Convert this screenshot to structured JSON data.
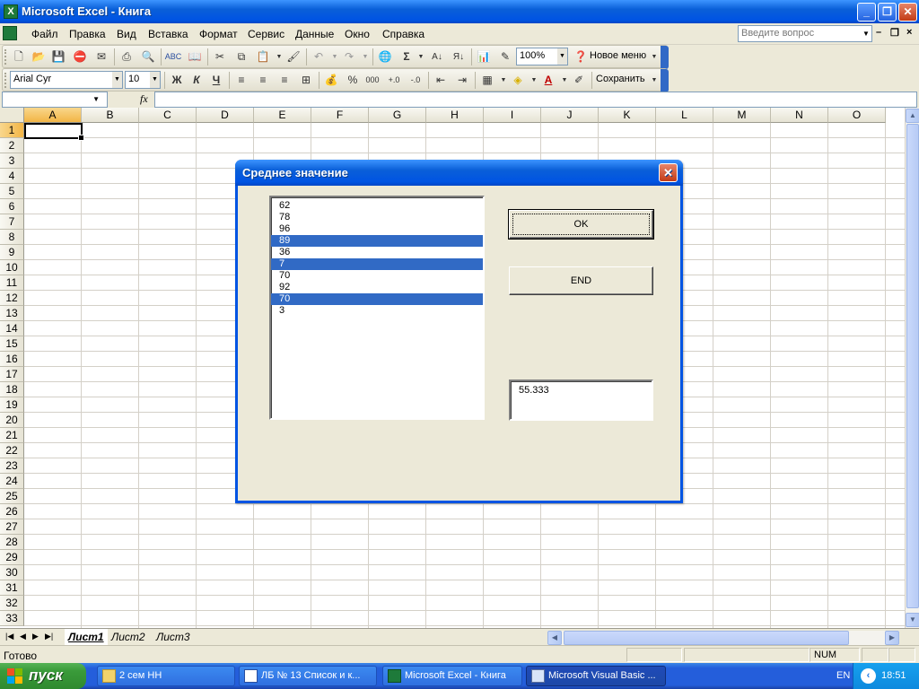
{
  "window": {
    "title": "Microsoft Excel - Книга"
  },
  "menu": {
    "items": [
      "Файл",
      "Правка",
      "Вид",
      "Вставка",
      "Формат",
      "Сервис",
      "Данные",
      "Окно",
      "Справка"
    ],
    "help_placeholder": "Введите вопрос"
  },
  "toolbar_standard": {
    "zoom": "100%",
    "new_menu_label": "Новое меню"
  },
  "toolbar_format": {
    "font_name": "Arial Cyr",
    "font_size": "10",
    "bold": "Ж",
    "italic": "К",
    "underline": "Ч",
    "percent": "%",
    "thousands": "000",
    "save_label": "Сохранить"
  },
  "formula_bar": {
    "fx": "fx"
  },
  "grid": {
    "columns": [
      "A",
      "B",
      "C",
      "D",
      "E",
      "F",
      "G",
      "H",
      "I",
      "J",
      "K",
      "L",
      "M",
      "N",
      "O"
    ],
    "rows": [
      "1",
      "2",
      "3",
      "4",
      "5",
      "6",
      "7",
      "8",
      "9",
      "10",
      "11",
      "12",
      "13",
      "14",
      "15",
      "16",
      "17",
      "18",
      "19",
      "20",
      "21",
      "22",
      "23",
      "24",
      "25",
      "26",
      "27",
      "28",
      "29",
      "30",
      "31",
      "32",
      "33"
    ],
    "active_column": "A",
    "active_row": "1"
  },
  "sheets": {
    "tabs": [
      "Лист1",
      "Лист2",
      "Лист3"
    ],
    "active": "Лист1"
  },
  "status": {
    "text": "Готово",
    "num": "NUM"
  },
  "dialog": {
    "title": "Среднее значение",
    "list": [
      {
        "value": "62",
        "selected": false
      },
      {
        "value": "78",
        "selected": false
      },
      {
        "value": "96",
        "selected": false
      },
      {
        "value": "89",
        "selected": true
      },
      {
        "value": "36",
        "selected": false
      },
      {
        "value": "7",
        "selected": true
      },
      {
        "value": "70",
        "selected": false
      },
      {
        "value": "92",
        "selected": false
      },
      {
        "value": "70",
        "selected": true
      },
      {
        "value": "3",
        "selected": false
      }
    ],
    "ok_label": "OK",
    "end_label": "END",
    "result": "55.333"
  },
  "taskbar": {
    "start_label": "пуск",
    "items": [
      {
        "label": "2 сем НН",
        "active": false
      },
      {
        "label": "ЛБ № 13 Список и к...",
        "active": false
      },
      {
        "label": "Microsoft Excel - Книга",
        "active": false
      },
      {
        "label": "Microsoft Visual Basic ...",
        "active": true
      }
    ],
    "language": "EN",
    "clock": "18:51"
  },
  "colors": {
    "selection": "#316ac5",
    "title_blue": "#0054e3",
    "active_header": "#f2b545"
  }
}
